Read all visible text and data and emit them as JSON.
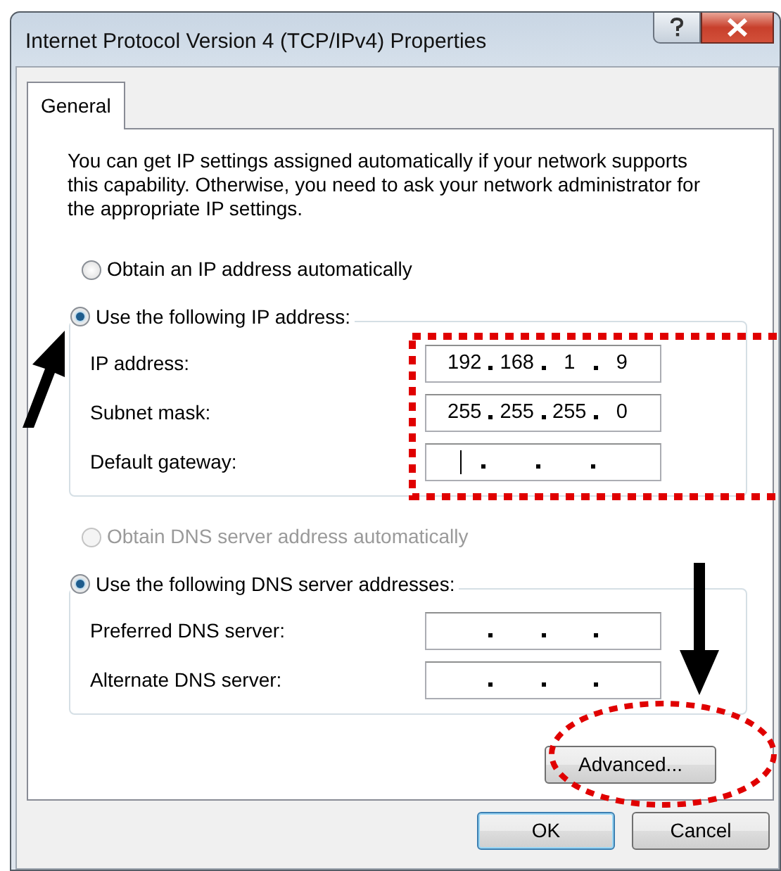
{
  "window": {
    "title": "Internet Protocol Version 4 (TCP/IPv4) Properties"
  },
  "tabs": [
    {
      "label": "General",
      "selected": true
    }
  ],
  "description": "You can get IP settings assigned automatically if your network supports this capability. Otherwise, you need to ask your network administrator for the appropriate IP settings.",
  "ip_group": {
    "auto_option": {
      "label": "Obtain an IP address automatically",
      "selected": false,
      "disabled": false
    },
    "manual_option": {
      "label": "Use the following IP address:",
      "selected": true,
      "disabled": false
    },
    "fields": [
      {
        "label": "IP address:",
        "octets": [
          "192",
          "168",
          "1",
          "9"
        ],
        "focused": false
      },
      {
        "label": "Subnet mask:",
        "octets": [
          "255",
          "255",
          "255",
          "0"
        ],
        "focused": false
      },
      {
        "label": "Default gateway:",
        "focused": true
      }
    ]
  },
  "dns_group": {
    "auto_option": {
      "label": "Obtain DNS server address automatically",
      "selected": false,
      "disabled": true
    },
    "manual_option": {
      "label": "Use the following DNS server addresses:",
      "selected": true,
      "disabled": false
    },
    "fields": [
      {
        "label": "Preferred DNS server:",
        "focused": false
      },
      {
        "label": "Alternate DNS server:",
        "focused": false
      }
    ]
  },
  "advanced_button": "Advanced...",
  "buttons": [
    {
      "label": "OK",
      "default": true
    },
    {
      "label": "Cancel",
      "default": false
    }
  ]
}
